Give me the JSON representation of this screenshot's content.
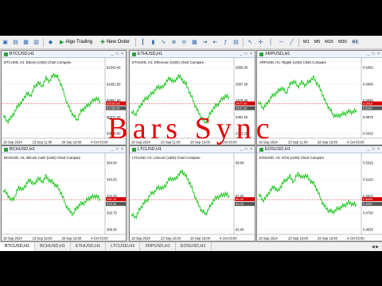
{
  "toolbar": {
    "algo_trading": "Algo Trading",
    "new_order": "New Order",
    "timeframes": [
      "M1",
      "M5",
      "M15",
      "M30",
      "H1"
    ],
    "active_timeframe": "H1"
  },
  "overlay_text": "Bars Sync",
  "tabs": [
    "BTCUSD,H1",
    "BCHUSD,H1",
    "ETHUSD,H1",
    "LTCUSD,H1",
    "XRPUSD,H1",
    "EOSUSD,H1"
  ],
  "active_tab": 0,
  "charts": [
    {
      "title": "BTCUSD,H1",
      "header": "BTCUSD, H1: Bitcoin (USD)   Chart Compare",
      "prices": [
        "62342.40",
        "61652.00",
        "60961.60",
        "60271.20",
        "59580.80"
      ],
      "tag_red": "62093.50",
      "tag_gray": "61780.50",
      "times": [
        "18 Sep 2024",
        "23 Sep 11:00",
        "28 Sep 19:00",
        "4 Oct 03:00"
      ]
    },
    {
      "title": "ETHUSD,H1",
      "header": "ETHUSD, H1: Ethereum (USD) Chart Compare",
      "prices": [
        "2655.00",
        "2567.30",
        "2479.40",
        "2391.20",
        "2303.20"
      ],
      "tag_red": "2477.90",
      "tag_gray": "2437.00",
      "times": [
        "18 Sep 2024",
        "23 Sep 11:00",
        "28 Sep 19:00",
        "4 Oct 03:00"
      ]
    },
    {
      "title": "XRPUSD,H1",
      "header": "XRPUSD, H1: Ripple (USD)  Chart Compare",
      "prices": [
        "0.6350",
        "0.6090",
        "0.5830",
        "0.5570",
        "0.5310"
      ],
      "tag_red": "0.5410",
      "tag_gray": "0.5397",
      "times": [
        "18 Sep 2024",
        "23 Sep 11:00",
        "28 Sep 19:00",
        "4 Oct 03:00"
      ]
    },
    {
      "title": "BCHUSD,H1",
      "header": "BCHUSD, H1: Bitcoin Cash (USD) Chart Compare",
      "prices": [
        "354.00",
        "343.50",
        "332.00",
        "320.70",
        "309.30"
      ],
      "tag_red": "330.70",
      "tag_gray": "328.30",
      "times": [
        "18 Sep 2024",
        "23 Sep 19:00",
        "28 Sep 19:00",
        "4 Oct 03:00"
      ]
    },
    {
      "title": "LTCUSD,H1",
      "header": "LTCUSD, H1: Litecoin (USD)  Chart Compare",
      "prices": [
        "69.60",
        "65.80",
        "62.00"
      ],
      "tag_red": "65.30",
      "tag_gray": "65.00",
      "times": [
        "18 Sep 2024",
        "23 Sep 10:00",
        "28 Sep 19:00",
        "4 Oct 03:00"
      ]
    },
    {
      "title": "EOSUSD,H1",
      "header": "EOSUSD, H1: EOS (USD)  Chart Compare",
      "prices": [
        "0.5315",
        "0.5120",
        "0.4925",
        "0.4730",
        "0.4535"
      ],
      "tag_red": "0.4890",
      "tag_gray": "0.4857",
      "times": [
        "18 Sep 2024",
        "23 Sep 19:00",
        "28 Sep 19:00",
        "4 Oct 03:00"
      ]
    }
  ],
  "chart_data": [
    {
      "type": "line",
      "title": "BTCUSD, H1: Bitcoin (USD)",
      "series": [
        {
          "values": [
            0.3,
            0.2,
            0.25,
            0.35,
            0.45,
            0.5,
            0.62,
            0.58,
            0.7,
            0.78,
            0.72,
            0.84,
            0.8,
            0.9,
            0.86,
            0.74,
            0.55,
            0.4,
            0.3,
            0.22,
            0.35,
            0.4,
            0.45,
            0.5,
            0.55,
            0.48
          ]
        }
      ]
    },
    {
      "type": "line",
      "title": "ETHUSD, H1: Ethereum (USD)",
      "series": [
        {
          "values": [
            0.35,
            0.3,
            0.4,
            0.5,
            0.55,
            0.6,
            0.66,
            0.72,
            0.7,
            0.8,
            0.84,
            0.78,
            0.88,
            0.82,
            0.75,
            0.62,
            0.48,
            0.35,
            0.25,
            0.18,
            0.3,
            0.4,
            0.45,
            0.52,
            0.58,
            0.55
          ]
        }
      ]
    },
    {
      "type": "line",
      "title": "XRPUSD, H1: Ripple (USD)",
      "series": [
        {
          "values": [
            0.5,
            0.4,
            0.45,
            0.55,
            0.6,
            0.65,
            0.7,
            0.62,
            0.75,
            0.8,
            0.72,
            0.78,
            0.74,
            0.8,
            0.85,
            0.76,
            0.65,
            0.5,
            0.4,
            0.3,
            0.28,
            0.3,
            0.32,
            0.35,
            0.34,
            0.36
          ]
        }
      ]
    },
    {
      "type": "line",
      "title": "BCHUSD, H1: Bitcoin Cash (USD)",
      "series": [
        {
          "values": [
            0.6,
            0.55,
            0.45,
            0.5,
            0.65,
            0.6,
            0.7,
            0.75,
            0.68,
            0.78,
            0.72,
            0.8,
            0.74,
            0.7,
            0.65,
            0.55,
            0.4,
            0.3,
            0.25,
            0.35,
            0.4,
            0.42,
            0.48,
            0.5,
            0.52,
            0.45
          ]
        }
      ]
    },
    {
      "type": "line",
      "title": "LTCUSD, H1: Litecoin (USD)",
      "series": [
        {
          "values": [
            0.25,
            0.2,
            0.3,
            0.4,
            0.45,
            0.55,
            0.58,
            0.65,
            0.62,
            0.7,
            0.78,
            0.75,
            0.82,
            0.88,
            0.8,
            0.7,
            0.55,
            0.4,
            0.3,
            0.25,
            0.35,
            0.45,
            0.5,
            0.52,
            0.55,
            0.5
          ]
        }
      ]
    },
    {
      "type": "line",
      "title": "EOSUSD, H1: EOS (USD)",
      "series": [
        {
          "values": [
            0.55,
            0.45,
            0.5,
            0.6,
            0.65,
            0.58,
            0.7,
            0.75,
            0.8,
            0.72,
            0.85,
            0.78,
            0.82,
            0.75,
            0.7,
            0.6,
            0.45,
            0.35,
            0.3,
            0.28,
            0.32,
            0.35,
            0.38,
            0.42,
            0.4,
            0.38
          ]
        }
      ]
    }
  ]
}
